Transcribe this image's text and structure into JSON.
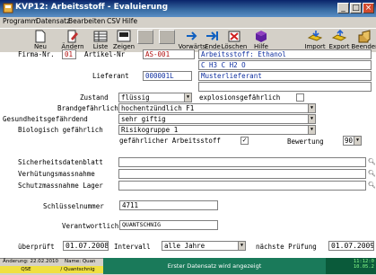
{
  "window": {
    "title": "KVP12: Arbeitsstoff - Evaluierung"
  },
  "menu": [
    "Programm",
    "Datensatz",
    "Bearbeiten",
    "CSV",
    "Hilfe"
  ],
  "toolbar": {
    "buttons": [
      {
        "label": "Neu",
        "icon": "new-icon"
      },
      {
        "label": "Ändern",
        "icon": "edit-icon"
      },
      {
        "label": "Liste",
        "icon": "list-icon"
      },
      {
        "label": "Zeigen",
        "icon": "view-icon"
      },
      {
        "label": "",
        "icon": "disabled"
      },
      {
        "label": "",
        "icon": "disabled"
      },
      {
        "label": "Vorwärts",
        "icon": "forward-icon"
      },
      {
        "label": "Ende",
        "icon": "end-icon"
      },
      {
        "label": "Löschen",
        "icon": "delete-icon"
      },
      {
        "label": "Hilfe",
        "icon": "help-icon"
      },
      {
        "label": "Import",
        "icon": "import-icon"
      },
      {
        "label": "Export",
        "icon": "export-icon"
      },
      {
        "label": "Beenden",
        "icon": "exit-icon"
      }
    ]
  },
  "form": {
    "firma_label": "Firma-Nr.",
    "firma_value": "01",
    "artikel_label": "Artikel-Nr",
    "artikel_value": "AS-001",
    "artikel_name": "Arbeitsstoff: Ethanol",
    "formula": "C H3 C H2 O",
    "lieferant_label": "Lieferant",
    "lieferant_value": "000001L",
    "lieferant_name": "Musterlieferant",
    "zustand_label": "Zustand",
    "zustand_value": "flüssig",
    "explosion_label": "explosionsgefährlich",
    "brand_label": "Brandgefährlich",
    "brand_value": "hochentzündlich F1",
    "gesundheit_label": "Gesundheitsgefährdend",
    "gesundheit_value": "sehr giftig",
    "bio_label": "Biologisch gefährlich",
    "bio_value": "Risikogruppe 1",
    "gefaehrlich_label": "gefährlicher Arbeitsstoff",
    "gefaehrlich_check": "✓",
    "bewertung_label": "Bewertung",
    "bewertung_value": "90",
    "sdb_label": "Sicherheitsdatenblatt",
    "verhuetung_label": "Verhütungsmassnahme",
    "schutz_label": "Schutzmassnahme Lager",
    "schluessel_label": "Schlüsselnummer",
    "schluessel_value": "4711",
    "verantwortlich_label": "Verantwortlich",
    "verantwortlich_value": "QUANTSCHNIG",
    "ueberprueft_label": "überprüft",
    "ueberprueft_value": "01.07.2008",
    "intervall_label": "Intervall",
    "intervall_value": "alle Jahre",
    "naechste_label": "nächste Prüfung",
    "naechste_value": "01.07.2009"
  },
  "status": {
    "aenderung": "Änderung: 22.02.2010",
    "name": "Name: Quan",
    "qse": "QSE",
    "quantschnig": "/ Quantschnig",
    "banner": "Erster Datensatz wird angezeigt",
    "time": "11:12:0",
    "date": "10.05.2"
  },
  "colors": {
    "title_bg": "#0a246a",
    "status_green": "#1a7a5a",
    "value_red": "#b01010",
    "value_blue": "#1030a0"
  }
}
